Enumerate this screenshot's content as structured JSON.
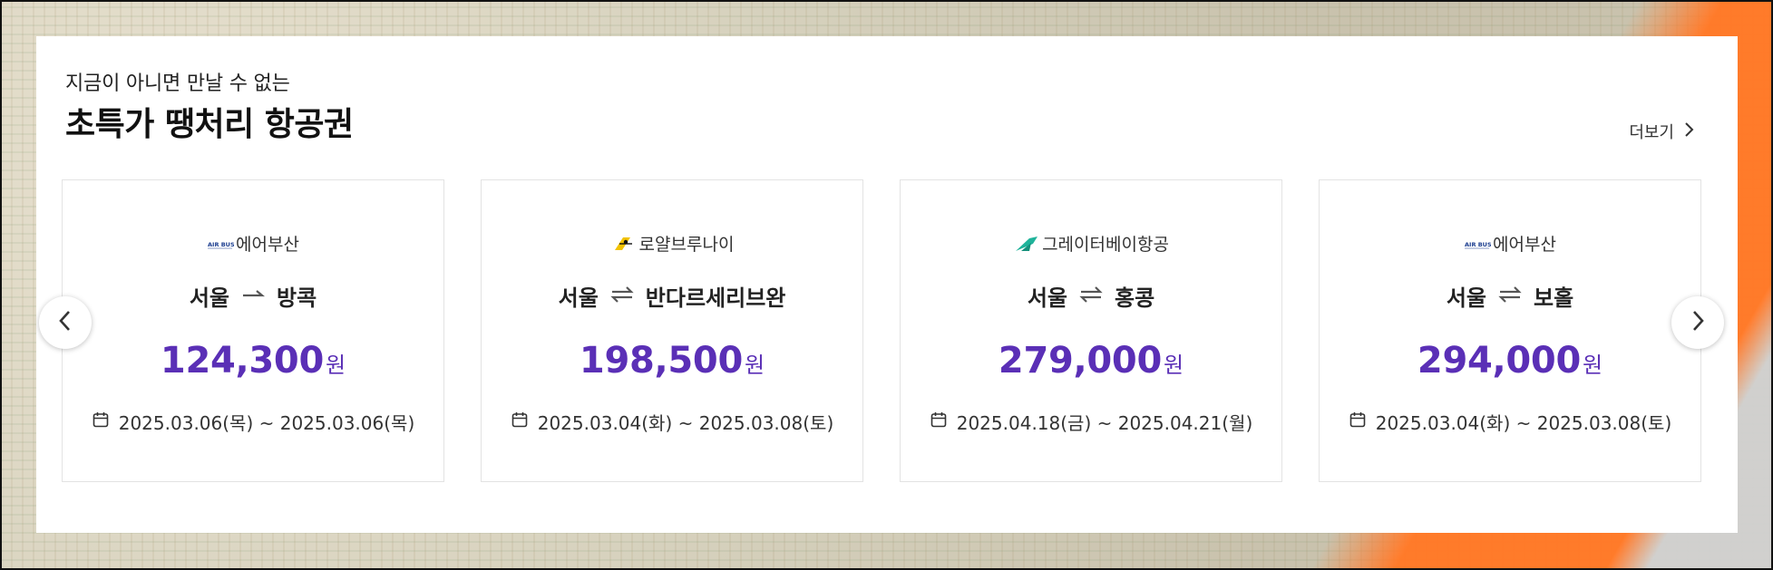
{
  "section": {
    "subtitle": "지금이 아니면 만날 수 없는",
    "title": "초특가 땡처리 항공권",
    "more_label": "더보기"
  },
  "colors": {
    "accent": "#5a2fb6",
    "text": "#222222",
    "border": "#e3e3e3"
  },
  "cards": [
    {
      "airline": "에어부산",
      "logo_icon": "air-busan-logo-icon",
      "origin": "서울",
      "trip_icon": "one-way-arrow-icon",
      "destination": "방콕",
      "price": "124,300",
      "currency": "원",
      "dates": "2025.03.06(목) ~ 2025.03.06(목)"
    },
    {
      "airline": "로얄브루나이",
      "logo_icon": "royal-brunei-logo-icon",
      "origin": "서울",
      "trip_icon": "round-trip-arrows-icon",
      "destination": "반다르세리브완",
      "price": "198,500",
      "currency": "원",
      "dates": "2025.03.04(화) ~ 2025.03.08(토)"
    },
    {
      "airline": "그레이터베이항공",
      "logo_icon": "greater-bay-airlines-logo-icon",
      "origin": "서울",
      "trip_icon": "round-trip-arrows-icon",
      "destination": "홍콩",
      "price": "279,000",
      "currency": "원",
      "dates": "2025.04.18(금) ~ 2025.04.21(월)"
    },
    {
      "airline": "에어부산",
      "logo_icon": "air-busan-logo-icon",
      "origin": "서울",
      "trip_icon": "round-trip-arrows-icon",
      "destination": "보홀",
      "price": "294,000",
      "currency": "원",
      "dates": "2025.03.04(화) ~ 2025.03.08(토)"
    }
  ]
}
